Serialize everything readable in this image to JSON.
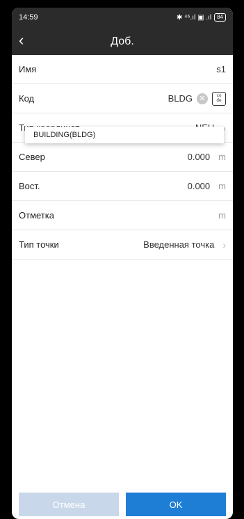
{
  "status": {
    "time": "14:59",
    "icons": "✱ ⁴⁶.ıl ▣ .ıl",
    "battery": "84"
  },
  "header": {
    "back_icon": "chevron-left",
    "title": "Доб."
  },
  "fields": [
    {
      "label": "Имя",
      "value": "s1"
    },
    {
      "label": "Код",
      "value": "BLDG"
    },
    {
      "label": "Тип координат",
      "value": "NEH"
    },
    {
      "label": "Север",
      "value": "0.000",
      "unit": "m"
    },
    {
      "label": "Вост.",
      "value": "0.000",
      "unit": "m"
    },
    {
      "label": "Отметка",
      "value": "",
      "unit": "m"
    },
    {
      "label": "Тип точки",
      "value": "Введенная точка"
    }
  ],
  "suggestion": "BUILDING(BLDG)",
  "footer": {
    "cancel": "Отмена",
    "ok": "OK"
  },
  "colors": {
    "header_bg": "#2b2b2b",
    "ok_bg": "#1e7ed6",
    "cancel_bg": "#c8d8ea"
  }
}
